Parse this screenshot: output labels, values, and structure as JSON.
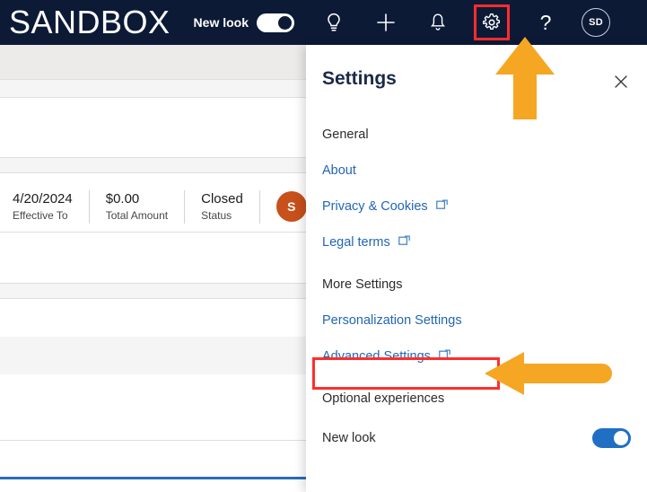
{
  "header": {
    "brand": "SANDBOX",
    "newlook_label": "New look",
    "newlook_state": "on",
    "icons": [
      {
        "name": "lightbulb-icon",
        "label": "Lightbulb"
      },
      {
        "name": "plus-icon",
        "label": "New"
      },
      {
        "name": "bell-icon",
        "label": "Notifications"
      }
    ],
    "gear_label": "Settings",
    "help_label": "?",
    "avatar_initials": "SD",
    "background_color": "#0d1a36"
  },
  "record": {
    "fields": [
      {
        "value": "4/20/2024",
        "label": "Effective To"
      },
      {
        "value": "$0.00",
        "label": "Total Amount"
      },
      {
        "value": "Closed",
        "label": "Status"
      }
    ],
    "owner_avatar_initial": "S",
    "owner_avatar_color": "#c8501b"
  },
  "settings_panel": {
    "title": "Settings",
    "close_label": "Close",
    "sections": [
      {
        "heading": "General",
        "links": [
          {
            "label": "About",
            "external": false
          },
          {
            "label": "Privacy & Cookies",
            "external": true
          },
          {
            "label": "Legal terms",
            "external": true
          }
        ]
      },
      {
        "heading": "More Settings",
        "links": [
          {
            "label": "Personalization Settings",
            "external": false
          },
          {
            "label": "Advanced Settings",
            "external": true,
            "highlighted": true
          }
        ]
      }
    ],
    "optional": {
      "heading": "Optional experiences",
      "toggle_label": "New look",
      "toggle_state": "on",
      "toggle_color": "#1f6fc4"
    },
    "link_color": "#2266b5"
  },
  "annotations": {
    "highlight_color": "#ff2d2d",
    "arrow_color": "#f5a623",
    "arrow_up_target": "Settings gear icon",
    "arrow_left_target": "Advanced Settings link"
  }
}
